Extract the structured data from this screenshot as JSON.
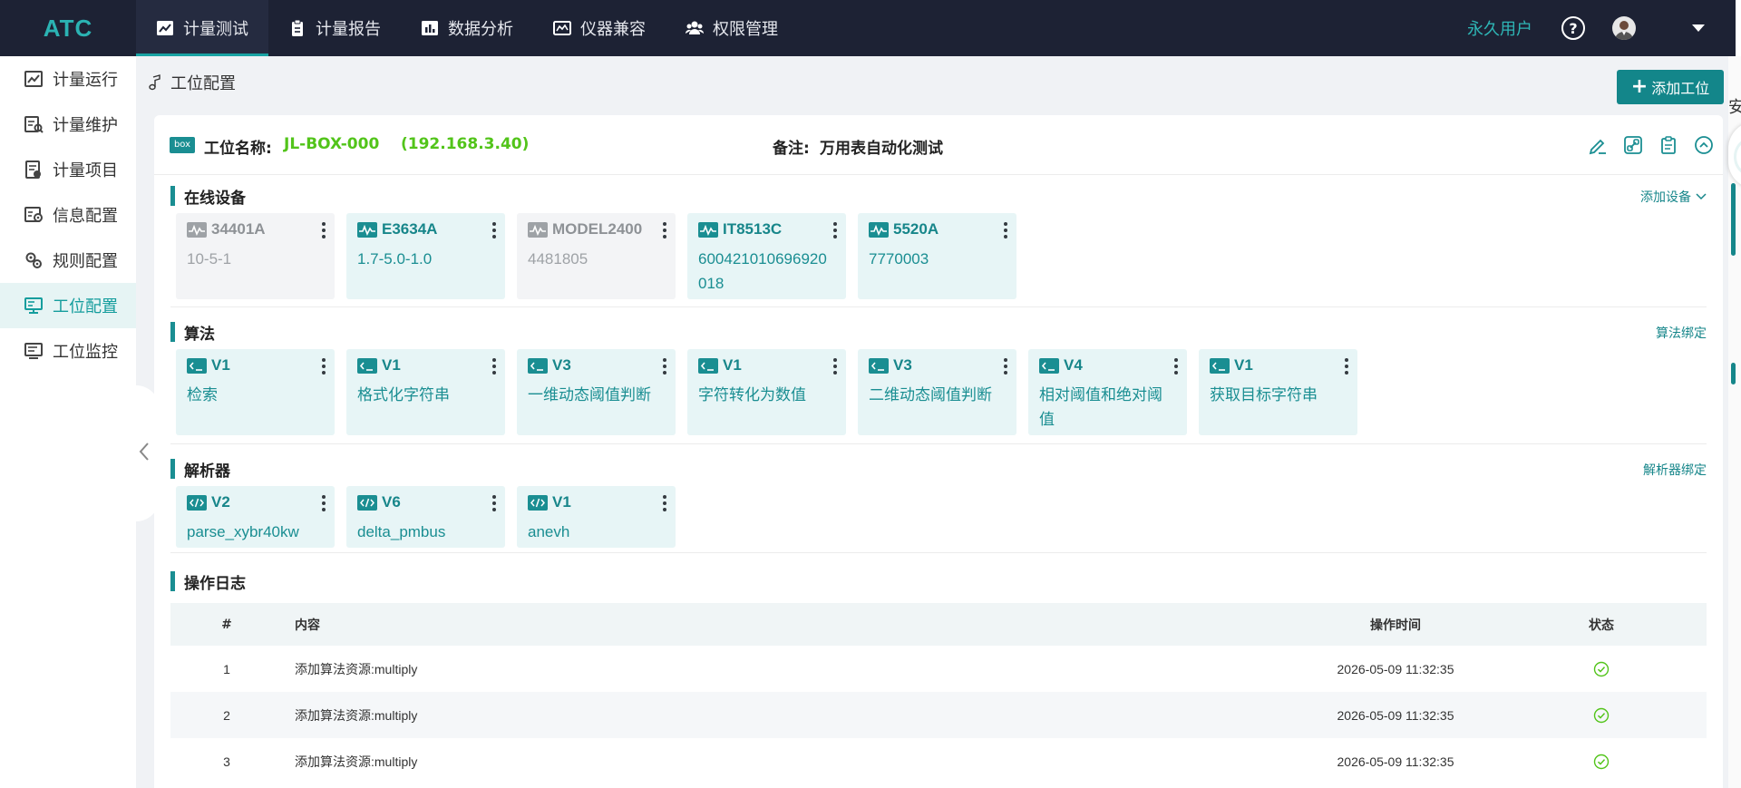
{
  "app": {
    "logo": "ATC",
    "user_label": "永久用户",
    "help_glyph": "?"
  },
  "nav": {
    "tabs": [
      {
        "label": "计量测试",
        "icon": "chart-line-icon",
        "active": true
      },
      {
        "label": "计量报告",
        "icon": "clipboard-icon",
        "active": false
      },
      {
        "label": "数据分析",
        "icon": "bar-chart-icon",
        "active": false
      },
      {
        "label": "仪器兼容",
        "icon": "dashboard-icon",
        "active": false
      },
      {
        "label": "权限管理",
        "icon": "users-icon",
        "active": false
      }
    ]
  },
  "sidebar": {
    "items": [
      {
        "label": "计量运行",
        "icon": "run-chart-icon",
        "active": false
      },
      {
        "label": "计量维护",
        "icon": "maintain-icon",
        "active": false
      },
      {
        "label": "计量项目",
        "icon": "project-icon",
        "active": false
      },
      {
        "label": "信息配置",
        "icon": "info-config-icon",
        "active": false
      },
      {
        "label": "规则配置",
        "icon": "rule-config-icon",
        "active": false
      },
      {
        "label": "工位配置",
        "icon": "station-config-icon",
        "active": true
      },
      {
        "label": "工位监控",
        "icon": "station-monitor-icon",
        "active": false
      }
    ]
  },
  "page": {
    "title": "工位配置",
    "add_button": "添加工位"
  },
  "station": {
    "box_badge": "box",
    "name_label": "工位名称:",
    "name": "JL-BOX-000",
    "ip": "(192.168.3.40)",
    "remark_label": "备注:",
    "remark": "万用表自动化测试"
  },
  "devices": {
    "title": "在线设备",
    "action": "添加设备",
    "items": [
      {
        "name": "34401A",
        "sub": "10-5-1",
        "online": false
      },
      {
        "name": "E3634A",
        "sub": "1.7-5.0-1.0",
        "online": true
      },
      {
        "name": "MODEL2400",
        "sub": "4481805",
        "online": false
      },
      {
        "name": "IT8513C",
        "sub": "600421010696920018",
        "online": true
      },
      {
        "name": "5520A",
        "sub": "7770003",
        "online": true
      }
    ]
  },
  "algorithms": {
    "title": "算法",
    "action": "算法绑定",
    "items": [
      {
        "version": "V1",
        "name": "检索"
      },
      {
        "version": "V1",
        "name": "格式化字符串"
      },
      {
        "version": "V3",
        "name": "一维动态阈值判断"
      },
      {
        "version": "V1",
        "name": "字符转化为数值"
      },
      {
        "version": "V3",
        "name": "二维动态阈值判断"
      },
      {
        "version": "V4",
        "name": "相对阈值和绝对阈值"
      },
      {
        "version": "V1",
        "name": "获取目标字符串"
      }
    ]
  },
  "parsers": {
    "title": "解析器",
    "action": "解析器绑定",
    "items": [
      {
        "version": "V2",
        "name": "parse_xybr40kw"
      },
      {
        "version": "V6",
        "name": "delta_pmbus"
      },
      {
        "version": "V1",
        "name": "anevh"
      }
    ]
  },
  "log": {
    "title": "操作日志",
    "headers": {
      "idx": "#",
      "content": "内容",
      "time": "操作时间",
      "status": "状态"
    },
    "rows": [
      {
        "idx": "1",
        "content": "添加算法资源:multiply",
        "time": "2026-05-09 11:32:35",
        "status": "success"
      },
      {
        "idx": "2",
        "content": "添加算法资源:multiply",
        "time": "2026-05-09 11:32:35",
        "status": "success"
      },
      {
        "idx": "3",
        "content": "添加算法资源:multiply",
        "time": "2026-05-09 11:32:35",
        "status": "success"
      }
    ]
  },
  "edge": {
    "partial_text": "安"
  },
  "colors": {
    "accent": "#1a8e92",
    "nav_bg": "#1d2234",
    "online_name": "#52c41a",
    "tile_bg": "#e7f5f6"
  }
}
